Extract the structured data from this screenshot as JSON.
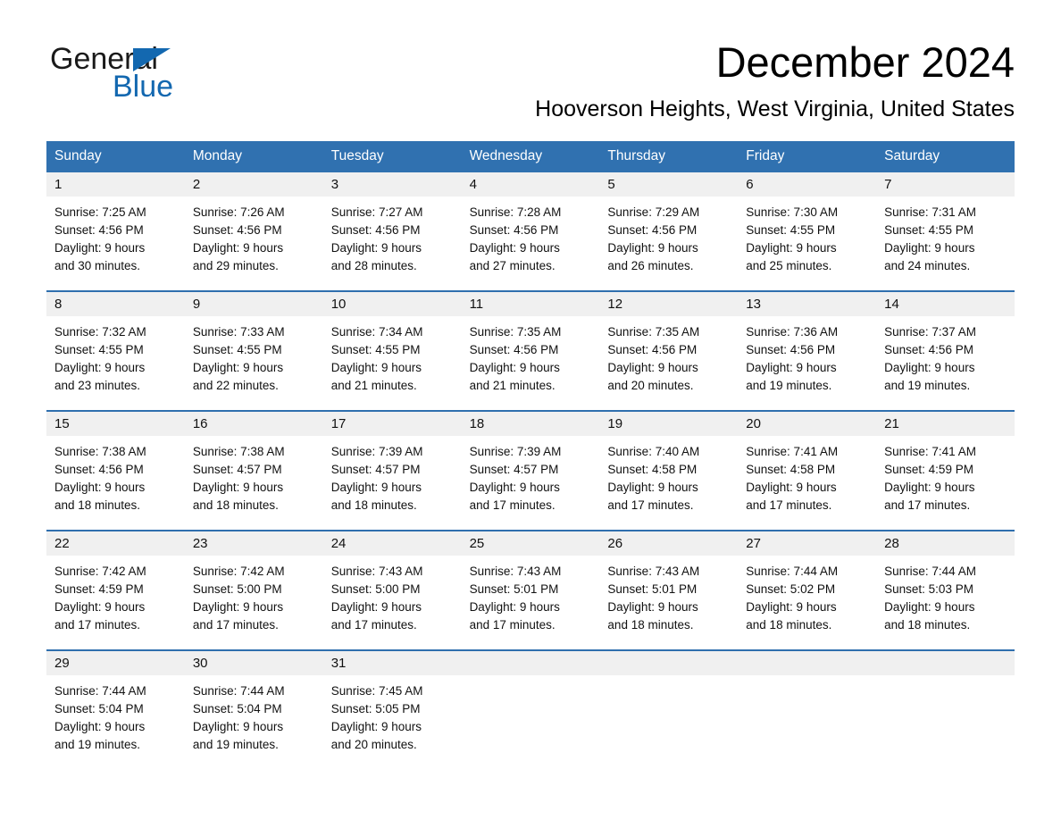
{
  "brand": {
    "name_part1": "General",
    "name_part2": "Blue",
    "accent_color": "#1368b0"
  },
  "header": {
    "month_title": "December 2024",
    "location": "Hooverson Heights, West Virginia, United States"
  },
  "calendar": {
    "header_bg": "#3071b0",
    "weekdays": [
      "Sunday",
      "Monday",
      "Tuesday",
      "Wednesday",
      "Thursday",
      "Friday",
      "Saturday"
    ],
    "weeks": [
      [
        {
          "day": "1",
          "sunrise": "Sunrise: 7:25 AM",
          "sunset": "Sunset: 4:56 PM",
          "daylight_line1": "Daylight: 9 hours",
          "daylight_line2": "and 30 minutes."
        },
        {
          "day": "2",
          "sunrise": "Sunrise: 7:26 AM",
          "sunset": "Sunset: 4:56 PM",
          "daylight_line1": "Daylight: 9 hours",
          "daylight_line2": "and 29 minutes."
        },
        {
          "day": "3",
          "sunrise": "Sunrise: 7:27 AM",
          "sunset": "Sunset: 4:56 PM",
          "daylight_line1": "Daylight: 9 hours",
          "daylight_line2": "and 28 minutes."
        },
        {
          "day": "4",
          "sunrise": "Sunrise: 7:28 AM",
          "sunset": "Sunset: 4:56 PM",
          "daylight_line1": "Daylight: 9 hours",
          "daylight_line2": "and 27 minutes."
        },
        {
          "day": "5",
          "sunrise": "Sunrise: 7:29 AM",
          "sunset": "Sunset: 4:56 PM",
          "daylight_line1": "Daylight: 9 hours",
          "daylight_line2": "and 26 minutes."
        },
        {
          "day": "6",
          "sunrise": "Sunrise: 7:30 AM",
          "sunset": "Sunset: 4:55 PM",
          "daylight_line1": "Daylight: 9 hours",
          "daylight_line2": "and 25 minutes."
        },
        {
          "day": "7",
          "sunrise": "Sunrise: 7:31 AM",
          "sunset": "Sunset: 4:55 PM",
          "daylight_line1": "Daylight: 9 hours",
          "daylight_line2": "and 24 minutes."
        }
      ],
      [
        {
          "day": "8",
          "sunrise": "Sunrise: 7:32 AM",
          "sunset": "Sunset: 4:55 PM",
          "daylight_line1": "Daylight: 9 hours",
          "daylight_line2": "and 23 minutes."
        },
        {
          "day": "9",
          "sunrise": "Sunrise: 7:33 AM",
          "sunset": "Sunset: 4:55 PM",
          "daylight_line1": "Daylight: 9 hours",
          "daylight_line2": "and 22 minutes."
        },
        {
          "day": "10",
          "sunrise": "Sunrise: 7:34 AM",
          "sunset": "Sunset: 4:55 PM",
          "daylight_line1": "Daylight: 9 hours",
          "daylight_line2": "and 21 minutes."
        },
        {
          "day": "11",
          "sunrise": "Sunrise: 7:35 AM",
          "sunset": "Sunset: 4:56 PM",
          "daylight_line1": "Daylight: 9 hours",
          "daylight_line2": "and 21 minutes."
        },
        {
          "day": "12",
          "sunrise": "Sunrise: 7:35 AM",
          "sunset": "Sunset: 4:56 PM",
          "daylight_line1": "Daylight: 9 hours",
          "daylight_line2": "and 20 minutes."
        },
        {
          "day": "13",
          "sunrise": "Sunrise: 7:36 AM",
          "sunset": "Sunset: 4:56 PM",
          "daylight_line1": "Daylight: 9 hours",
          "daylight_line2": "and 19 minutes."
        },
        {
          "day": "14",
          "sunrise": "Sunrise: 7:37 AM",
          "sunset": "Sunset: 4:56 PM",
          "daylight_line1": "Daylight: 9 hours",
          "daylight_line2": "and 19 minutes."
        }
      ],
      [
        {
          "day": "15",
          "sunrise": "Sunrise: 7:38 AM",
          "sunset": "Sunset: 4:56 PM",
          "daylight_line1": "Daylight: 9 hours",
          "daylight_line2": "and 18 minutes."
        },
        {
          "day": "16",
          "sunrise": "Sunrise: 7:38 AM",
          "sunset": "Sunset: 4:57 PM",
          "daylight_line1": "Daylight: 9 hours",
          "daylight_line2": "and 18 minutes."
        },
        {
          "day": "17",
          "sunrise": "Sunrise: 7:39 AM",
          "sunset": "Sunset: 4:57 PM",
          "daylight_line1": "Daylight: 9 hours",
          "daylight_line2": "and 18 minutes."
        },
        {
          "day": "18",
          "sunrise": "Sunrise: 7:39 AM",
          "sunset": "Sunset: 4:57 PM",
          "daylight_line1": "Daylight: 9 hours",
          "daylight_line2": "and 17 minutes."
        },
        {
          "day": "19",
          "sunrise": "Sunrise: 7:40 AM",
          "sunset": "Sunset: 4:58 PM",
          "daylight_line1": "Daylight: 9 hours",
          "daylight_line2": "and 17 minutes."
        },
        {
          "day": "20",
          "sunrise": "Sunrise: 7:41 AM",
          "sunset": "Sunset: 4:58 PM",
          "daylight_line1": "Daylight: 9 hours",
          "daylight_line2": "and 17 minutes."
        },
        {
          "day": "21",
          "sunrise": "Sunrise: 7:41 AM",
          "sunset": "Sunset: 4:59 PM",
          "daylight_line1": "Daylight: 9 hours",
          "daylight_line2": "and 17 minutes."
        }
      ],
      [
        {
          "day": "22",
          "sunrise": "Sunrise: 7:42 AM",
          "sunset": "Sunset: 4:59 PM",
          "daylight_line1": "Daylight: 9 hours",
          "daylight_line2": "and 17 minutes."
        },
        {
          "day": "23",
          "sunrise": "Sunrise: 7:42 AM",
          "sunset": "Sunset: 5:00 PM",
          "daylight_line1": "Daylight: 9 hours",
          "daylight_line2": "and 17 minutes."
        },
        {
          "day": "24",
          "sunrise": "Sunrise: 7:43 AM",
          "sunset": "Sunset: 5:00 PM",
          "daylight_line1": "Daylight: 9 hours",
          "daylight_line2": "and 17 minutes."
        },
        {
          "day": "25",
          "sunrise": "Sunrise: 7:43 AM",
          "sunset": "Sunset: 5:01 PM",
          "daylight_line1": "Daylight: 9 hours",
          "daylight_line2": "and 17 minutes."
        },
        {
          "day": "26",
          "sunrise": "Sunrise: 7:43 AM",
          "sunset": "Sunset: 5:01 PM",
          "daylight_line1": "Daylight: 9 hours",
          "daylight_line2": "and 18 minutes."
        },
        {
          "day": "27",
          "sunrise": "Sunrise: 7:44 AM",
          "sunset": "Sunset: 5:02 PM",
          "daylight_line1": "Daylight: 9 hours",
          "daylight_line2": "and 18 minutes."
        },
        {
          "day": "28",
          "sunrise": "Sunrise: 7:44 AM",
          "sunset": "Sunset: 5:03 PM",
          "daylight_line1": "Daylight: 9 hours",
          "daylight_line2": "and 18 minutes."
        }
      ],
      [
        {
          "day": "29",
          "sunrise": "Sunrise: 7:44 AM",
          "sunset": "Sunset: 5:04 PM",
          "daylight_line1": "Daylight: 9 hours",
          "daylight_line2": "and 19 minutes."
        },
        {
          "day": "30",
          "sunrise": "Sunrise: 7:44 AM",
          "sunset": "Sunset: 5:04 PM",
          "daylight_line1": "Daylight: 9 hours",
          "daylight_line2": "and 19 minutes."
        },
        {
          "day": "31",
          "sunrise": "Sunrise: 7:45 AM",
          "sunset": "Sunset: 5:05 PM",
          "daylight_line1": "Daylight: 9 hours",
          "daylight_line2": "and 20 minutes."
        },
        {
          "day": "",
          "sunrise": "",
          "sunset": "",
          "daylight_line1": "",
          "daylight_line2": ""
        },
        {
          "day": "",
          "sunrise": "",
          "sunset": "",
          "daylight_line1": "",
          "daylight_line2": ""
        },
        {
          "day": "",
          "sunrise": "",
          "sunset": "",
          "daylight_line1": "",
          "daylight_line2": ""
        },
        {
          "day": "",
          "sunrise": "",
          "sunset": "",
          "daylight_line1": "",
          "daylight_line2": ""
        }
      ]
    ]
  }
}
